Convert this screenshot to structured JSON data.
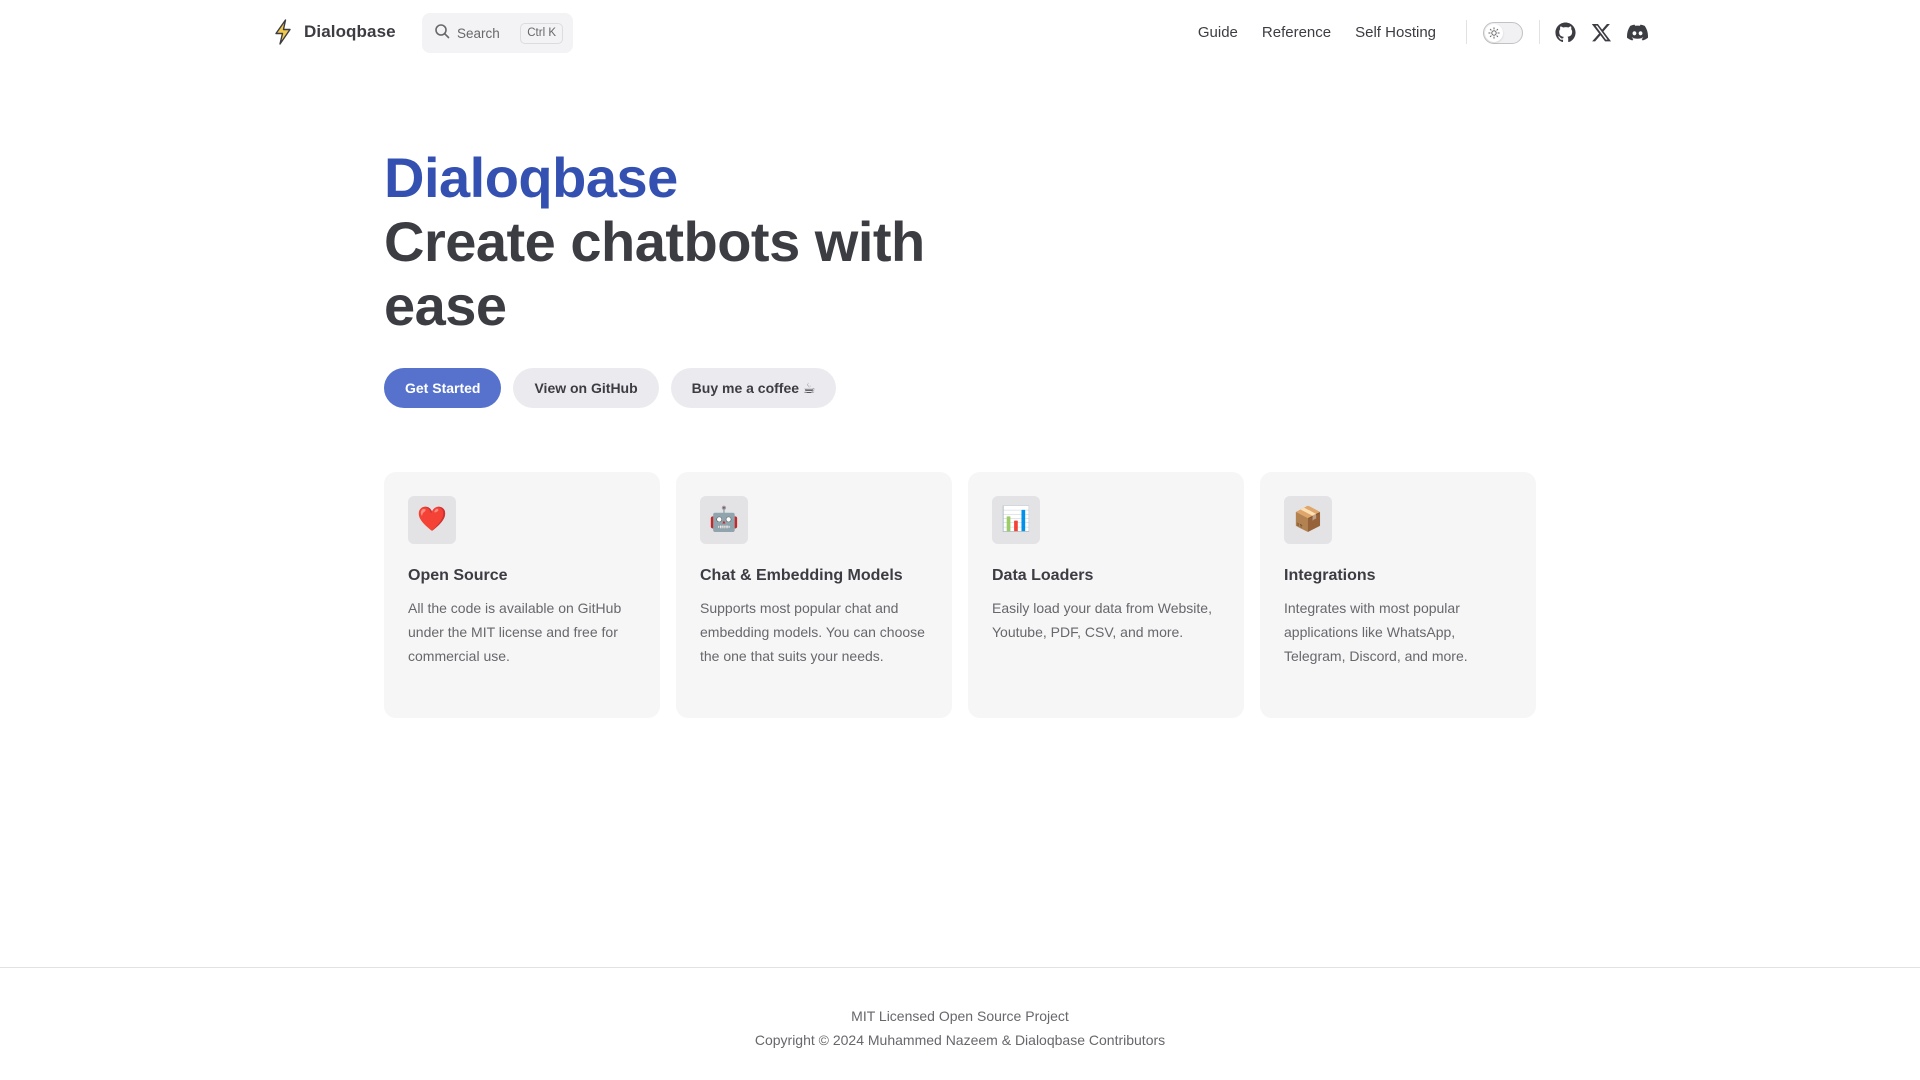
{
  "nav": {
    "brand": "Dialoqbase",
    "search_label": "Search",
    "search_shortcut": "Ctrl K",
    "links": [
      "Guide",
      "Reference",
      "Self Hosting"
    ],
    "social": [
      "github-icon",
      "x-icon",
      "discord-icon"
    ]
  },
  "hero": {
    "name": "Dialoqbase",
    "text": "Create chatbots with ease",
    "actions": [
      "Get Started",
      "View on GitHub",
      "Buy me a coffee ☕"
    ]
  },
  "features": [
    {
      "icon": "❤️",
      "title": "Open Source",
      "details": "All the code is available on GitHub under the MIT license and free for commercial use."
    },
    {
      "icon": "🤖",
      "title": "Chat & Embedding Models",
      "details": "Supports most popular chat and embedding models. You can choose the one that suits your needs."
    },
    {
      "icon": "📊",
      "title": "Data Loaders",
      "details": "Easily load your data from Website, Youtube, PDF, CSV, and more."
    },
    {
      "icon": "📦",
      "title": "Integrations",
      "details": "Integrates with most popular applications like WhatsApp, Telegram, Discord, and more."
    }
  ],
  "footer": {
    "message": "MIT Licensed Open Source Project",
    "copyright": "Copyright © 2024 Muhammed Nazeem & Dialoqbase Contributors"
  },
  "colors": {
    "brand": "#3451b2",
    "button": "#5672cd",
    "text": "#3c3c43",
    "muted": "#67676c",
    "card_bg": "#f6f6f7"
  }
}
